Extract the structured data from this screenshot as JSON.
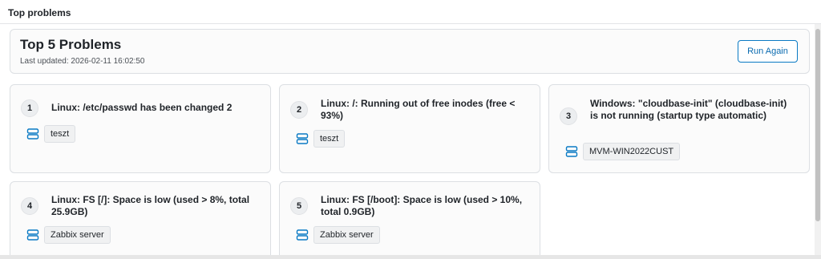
{
  "widget": {
    "title": "Top problems"
  },
  "summary": {
    "title": "Top 5 Problems",
    "last_updated": "Last updated: 2026-02-11 16:02:50",
    "run_again_label": "Run Again"
  },
  "accent_color": "#0a7ac4",
  "host_icon": "server-icon",
  "problems": [
    {
      "rank": "1",
      "name": "Linux: /etc/passwd has been changed 2",
      "host": "teszt"
    },
    {
      "rank": "2",
      "name": "Linux: /: Running out of free inodes (free < 93%)",
      "host": "teszt"
    },
    {
      "rank": "3",
      "name": "Windows: \"cloudbase-init\" (cloudbase-init) is not running (startup type automatic)",
      "host": "MVM-WIN2022CUST"
    },
    {
      "rank": "4",
      "name": "Linux: FS [/]: Space is low (used > 8%, total 25.9GB)",
      "host": "Zabbix server"
    },
    {
      "rank": "5",
      "name": "Linux: FS [/boot]: Space is low (used > 10%, total 0.9GB)",
      "host": "Zabbix server"
    }
  ]
}
